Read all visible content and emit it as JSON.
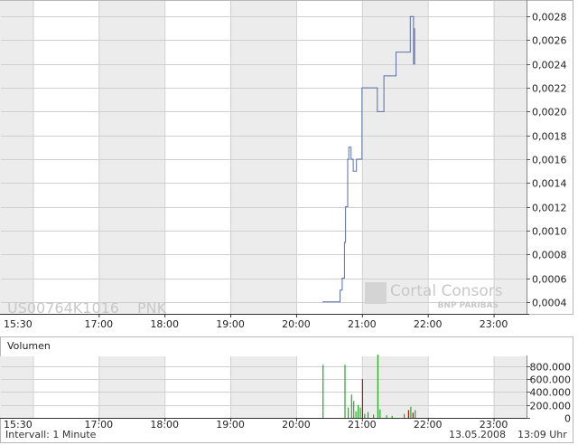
{
  "chart_data": [
    {
      "type": "line",
      "watermark": {
        "symbol": "US00764K1016",
        "exchange": "PNK",
        "logo_text": "Cortal Consors",
        "logo_subtext": "BNP PARIBAS"
      },
      "x_ticks": [
        "15:30",
        "17:00",
        "18:00",
        "19:00",
        "20:00",
        "21:00",
        "22:00",
        "23:00"
      ],
      "y_ticks": [
        "0,0004",
        "0,0006",
        "0,0008",
        "0,0010",
        "0,0012",
        "0,0014",
        "0,0016",
        "0,0018",
        "0,0020",
        "0,0022",
        "0,0024",
        "0,0026",
        "0,0028"
      ],
      "ylim": [
        0.0003,
        0.0029
      ],
      "xlim": [
        "15:30",
        "23:30"
      ],
      "color": "#5b6fa8",
      "series": [
        {
          "x": [
            "20:24",
            "20:38",
            "20:40",
            "20:42",
            "20:44",
            "20:45",
            "20:47",
            "20:48",
            "20:50",
            "20:52",
            "20:55",
            "20:57",
            "21:00",
            "21:12",
            "21:14",
            "21:20",
            "21:31",
            "21:42",
            "21:44",
            "21:47",
            "21:48"
          ],
          "y": [
            0.0004,
            0.0004,
            0.0005,
            0.0006,
            0.0009,
            0.0012,
            0.0016,
            0.0017,
            0.0016,
            0.0015,
            0.0016,
            0.0016,
            0.0022,
            0.0022,
            0.002,
            0.0023,
            0.0025,
            0.0025,
            0.0028,
            0.0024,
            0.0027
          ]
        }
      ]
    },
    {
      "type": "bar",
      "title": "Volumen",
      "x_ticks": [
        "15:30",
        "17:00",
        "18:00",
        "19:00",
        "20:00",
        "21:00",
        "22:00",
        "23:00"
      ],
      "y_ticks": [
        "0",
        "200.000",
        "400.000",
        "600.000",
        "800.000"
      ],
      "ylim": [
        0,
        950000
      ],
      "bars": [
        {
          "x": "20:24",
          "value": 820000,
          "color": "#22aa22"
        },
        {
          "x": "20:44",
          "value": 820000,
          "color": "#22aa22"
        },
        {
          "x": "20:47",
          "value": 160000,
          "color": "#22aa22"
        },
        {
          "x": "20:50",
          "value": 360000,
          "color": "#22aa22"
        },
        {
          "x": "20:52",
          "value": 260000,
          "color": "#22aa22"
        },
        {
          "x": "20:54",
          "value": 100000,
          "color": "#22aa22"
        },
        {
          "x": "20:56",
          "value": 200000,
          "color": "#22aa22"
        },
        {
          "x": "20:58",
          "value": 160000,
          "color": "#22aa22"
        },
        {
          "x": "21:00",
          "value": 600000,
          "color": "#aa1111"
        },
        {
          "x": "21:02",
          "value": 60000,
          "color": "#22aa22"
        },
        {
          "x": "21:05",
          "value": 90000,
          "color": "#22aa22"
        },
        {
          "x": "21:10",
          "value": 50000,
          "color": "#22aa22"
        },
        {
          "x": "21:14",
          "value": 1000000,
          "color": "#22aa22"
        },
        {
          "x": "21:16",
          "value": 130000,
          "color": "#22aa22"
        },
        {
          "x": "21:22",
          "value": 40000,
          "color": "#22aa22"
        },
        {
          "x": "21:27",
          "value": 30000,
          "color": "#22aa22"
        },
        {
          "x": "21:38",
          "value": 60000,
          "color": "#22aa22"
        },
        {
          "x": "21:42",
          "value": 120000,
          "color": "#aa1111"
        },
        {
          "x": "21:44",
          "value": 170000,
          "color": "#22aa22"
        },
        {
          "x": "21:46",
          "value": 80000,
          "color": "#aa1111"
        },
        {
          "x": "21:48",
          "value": 120000,
          "color": "#22aa22"
        }
      ]
    }
  ],
  "footer": {
    "interval": "Intervall: 1 Minute",
    "date": "13.05.2008",
    "time": "13:09 Uhr"
  }
}
